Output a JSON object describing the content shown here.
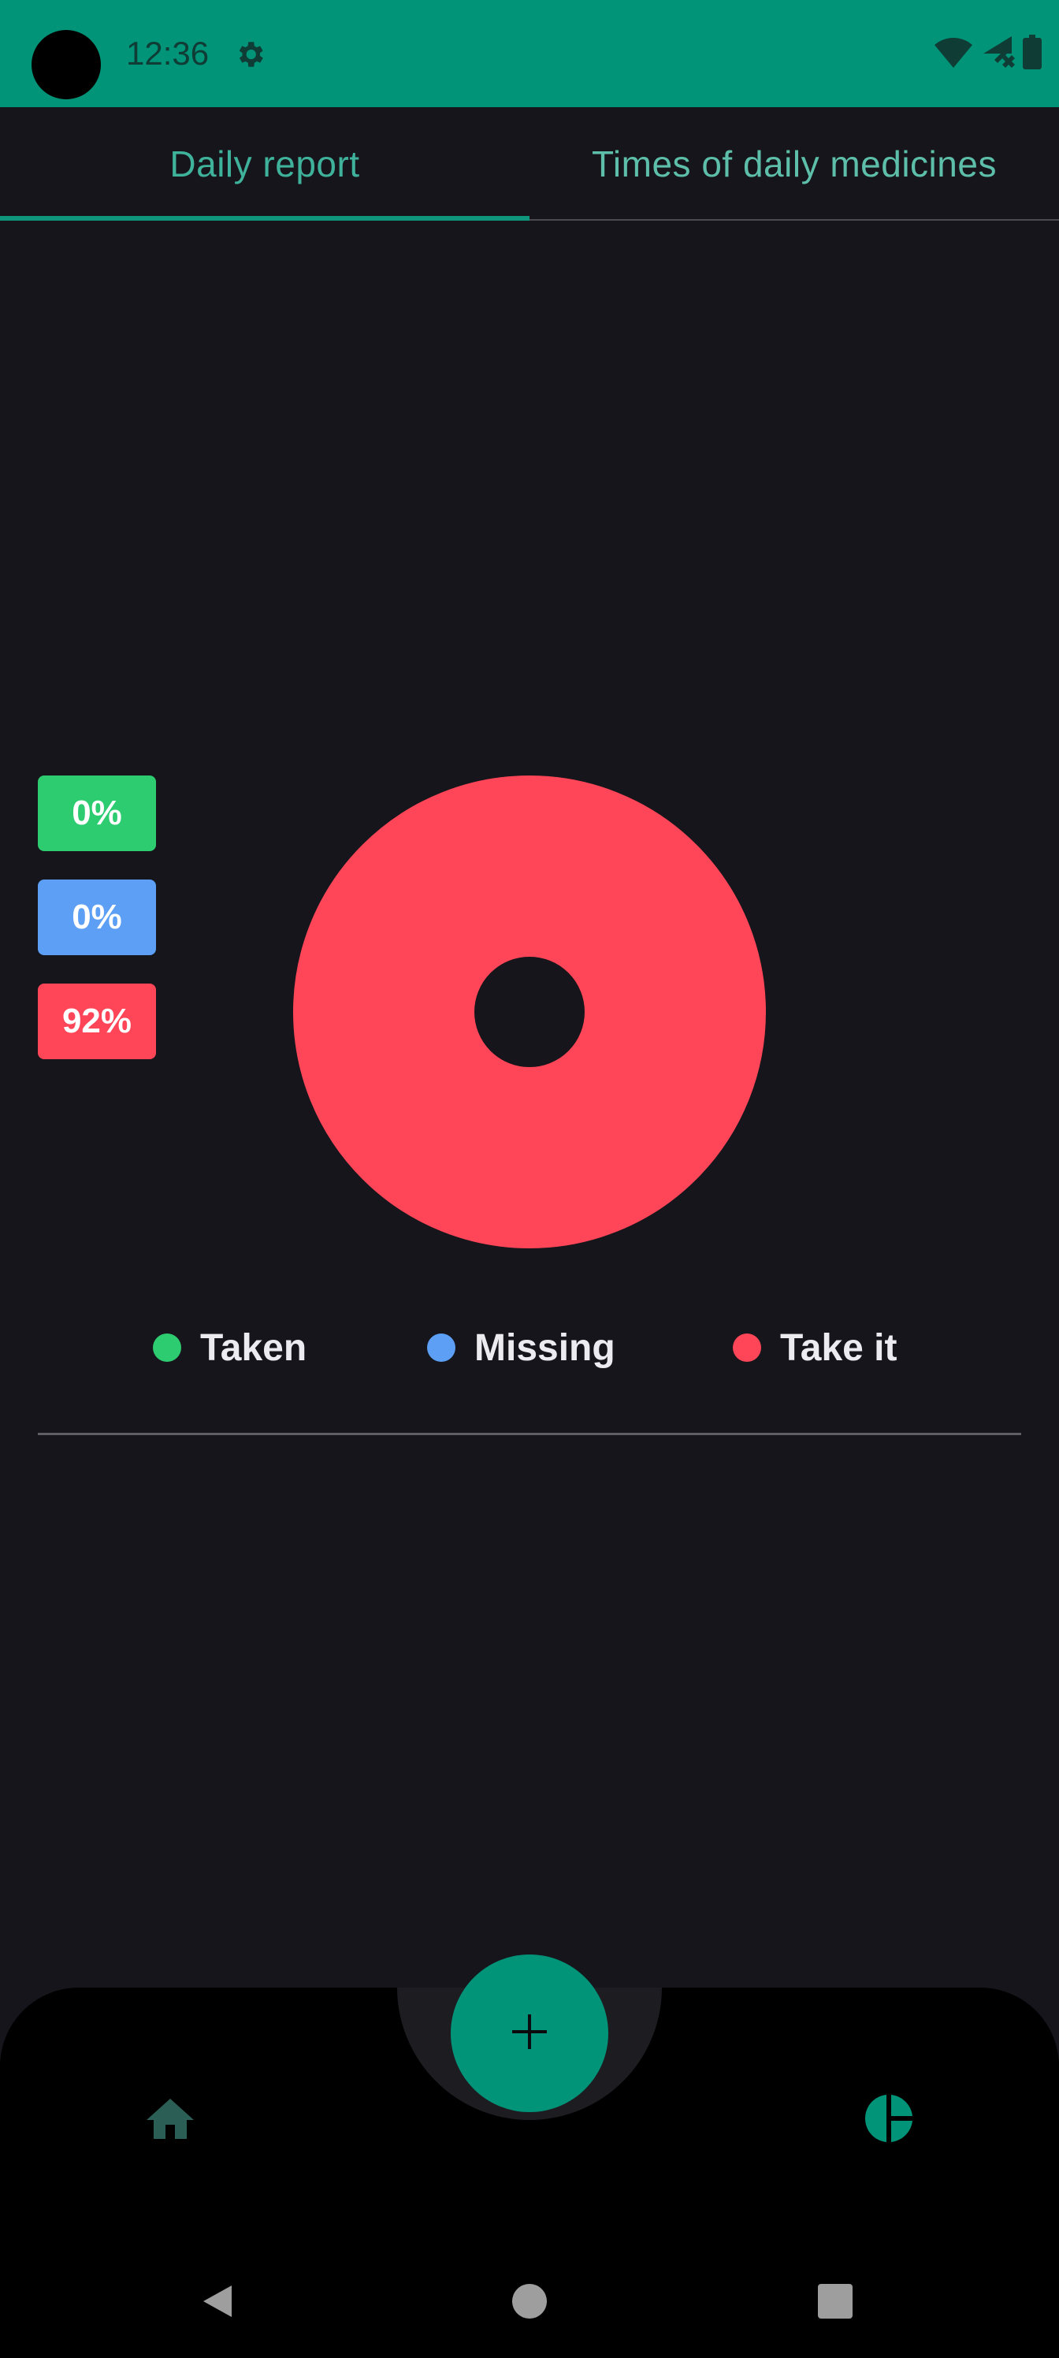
{
  "status_bar": {
    "time": "12:36",
    "icons": [
      "gear-icon",
      "wifi-icon",
      "signal-icon",
      "battery-icon"
    ],
    "background": "#019479"
  },
  "tabs": [
    {
      "label": "Daily report",
      "selected": true
    },
    {
      "label": "Times of daily medicines",
      "selected": false
    }
  ],
  "badges": [
    {
      "label": "0%",
      "color": "#2ecc71"
    },
    {
      "label": "0%",
      "color": "#5c9ff5"
    },
    {
      "label": "92%",
      "color": "#ff4658"
    }
  ],
  "chart_data": {
    "type": "pie",
    "variant": "donut",
    "slices": [
      {
        "label": "Taken",
        "value": 0,
        "color": "#2ecc71"
      },
      {
        "label": "Missing",
        "value": 0,
        "color": "#5c9ff5"
      },
      {
        "label": "Take it",
        "value": 92,
        "color": "#ff4658"
      }
    ],
    "legend_position": "bottom"
  },
  "legend": [
    {
      "label": "Taken",
      "color": "#2ecc71"
    },
    {
      "label": "Missing",
      "color": "#5c9ff5"
    },
    {
      "label": "Take it",
      "color": "#ff4658"
    }
  ],
  "bottom_nav": {
    "items": [
      "home-icon",
      "statistics-icon"
    ],
    "fab_icon": "plus-icon",
    "fab_color": "#019479"
  },
  "system_nav": [
    "back-icon",
    "home-circle-icon",
    "recents-icon"
  ]
}
